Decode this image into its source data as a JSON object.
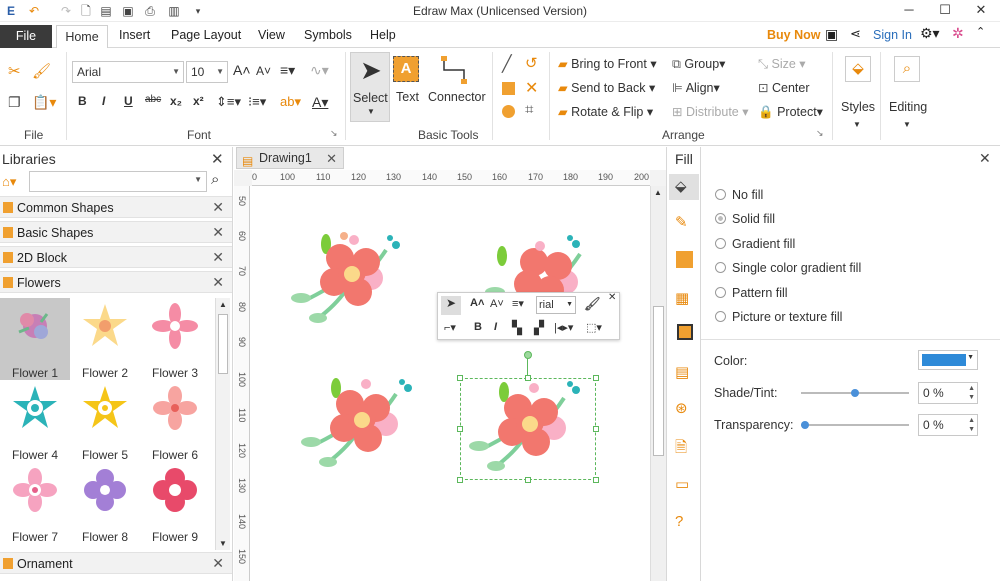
{
  "window": {
    "title": "Edraw Max (Unlicensed Version)"
  },
  "menu": {
    "file": "File",
    "tabs": [
      "Home",
      "Insert",
      "Page Layout",
      "View",
      "Symbols",
      "Help"
    ],
    "buy_now": "Buy Now",
    "sign_in": "Sign In"
  },
  "ribbon": {
    "font_name": "Arial",
    "font_size": "10",
    "groups": {
      "file": "File",
      "font": "Font",
      "basic_tools": "Basic Tools",
      "arrange": "Arrange"
    },
    "tools": {
      "select": "Select",
      "text": "Text",
      "connector": "Connector"
    },
    "arrange": {
      "bring_front": "Bring to Front",
      "send_back": "Send to Back",
      "rotate_flip": "Rotate & Flip",
      "group": "Group",
      "align": "Align",
      "distribute": "Distribute",
      "size": "Size",
      "center": "Center",
      "protect": "Protect"
    },
    "styles": "Styles",
    "editing": "Editing"
  },
  "libraries": {
    "title": "Libraries",
    "search_placeholder": "",
    "categories": [
      "Common Shapes",
      "Basic Shapes",
      "2D Block",
      "Flowers"
    ],
    "shapes": [
      "Flower 1",
      "Flower 2",
      "Flower 3",
      "Flower 4",
      "Flower 5",
      "Flower 6",
      "Flower 7",
      "Flower 8",
      "Flower 9"
    ],
    "bottom_category": "Ornament"
  },
  "document": {
    "tab": "Drawing1",
    "ruler_top": [
      "100",
      "110",
      "120",
      "130",
      "140",
      "150",
      "160",
      "170",
      "180",
      "190",
      "200"
    ],
    "ruler_top_first": "0",
    "ruler_left": [
      "50",
      "60",
      "70",
      "80",
      "90",
      "100",
      "110",
      "120",
      "130",
      "140",
      "150"
    ],
    "mini_font": "rial"
  },
  "fill": {
    "title": "Fill",
    "options": [
      "No fill",
      "Solid fill",
      "Gradient fill",
      "Single color gradient fill",
      "Pattern fill",
      "Picture or texture fill"
    ],
    "selected": "Solid fill",
    "color_label": "Color:",
    "color_value": "#2e8ad8",
    "shade_label": "Shade/Tint:",
    "shade_value": "0 %",
    "transparency_label": "Transparency:",
    "transparency_value": "0 %"
  },
  "colors": {
    "accent_orange": "#e8890c",
    "link_blue": "#2a6ebb",
    "flower_coral": "#f2776e"
  }
}
